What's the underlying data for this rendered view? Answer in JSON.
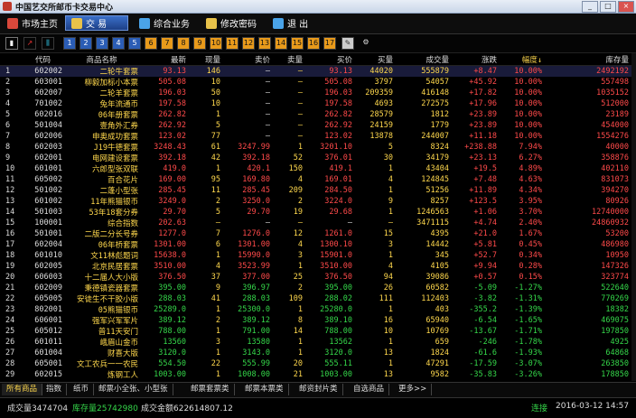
{
  "window": {
    "title": "中国艺交所邮币卡交易中心",
    "min": "_",
    "max": "□",
    "close": "×"
  },
  "menu": [
    {
      "label": "市场主页",
      "icon": "home-icon",
      "color": "#d9483b"
    },
    {
      "label": "交  易",
      "icon": "trade-icon",
      "color": "#e8c24a"
    },
    {
      "label": "综合业务",
      "icon": "business-icon",
      "color": "#4aa3e8"
    },
    {
      "label": "修改密码",
      "icon": "password-icon",
      "color": "#e8c24a"
    },
    {
      "label": "退    出",
      "icon": "exit-icon",
      "color": "#4aa3e8"
    }
  ],
  "toolbar": {
    "buttons": [
      "1",
      "2",
      "3",
      "4",
      "5",
      "6",
      "7",
      "8",
      "9",
      "10",
      "11",
      "12",
      "13",
      "14",
      "15",
      "16",
      "17"
    ]
  },
  "table": {
    "headers": [
      "",
      "代码",
      "商品名称",
      "最新",
      "现量",
      "卖价",
      "卖量",
      "买价",
      "买量",
      "成交量",
      "涨跌",
      "幅度↓",
      "库存量"
    ],
    "rows": [
      [
        "1",
        "602002",
        "二轮牛套票",
        "93.13",
        "146",
        "—",
        "—",
        "93.13",
        "44020",
        "555879",
        "+8.47",
        "10.00%",
        "2492192",
        "up"
      ],
      [
        "2",
        "603001",
        "柳毅加标小本票",
        "505.08",
        "10",
        "—",
        "—",
        "505.08",
        "3797",
        "54057",
        "+45.92",
        "10.00%",
        "557498",
        "up"
      ],
      [
        "3",
        "602007",
        "二轮羊套票",
        "196.03",
        "50",
        "—",
        "—",
        "196.03",
        "209359",
        "416148",
        "+17.82",
        "10.00%",
        "1035152",
        "up"
      ],
      [
        "4",
        "701002",
        "兔年流通币",
        "197.58",
        "10",
        "—",
        "—",
        "197.58",
        "4693",
        "272575",
        "+17.96",
        "10.00%",
        "512000",
        "up"
      ],
      [
        "5",
        "602016",
        "06年册套票",
        "262.82",
        "1",
        "—",
        "—",
        "262.82",
        "28579",
        "1812",
        "+23.89",
        "10.00%",
        "23189",
        "up"
      ],
      [
        "6",
        "501004",
        "壹角外汇券",
        "262.92",
        "5",
        "—",
        "—",
        "262.92",
        "24159",
        "1779",
        "+23.89",
        "10.00%",
        "454000",
        "up"
      ],
      [
        "7",
        "602006",
        "申奥成功套票",
        "123.02",
        "77",
        "—",
        "—",
        "123.02",
        "13878",
        "244007",
        "+11.18",
        "10.00%",
        "1554276",
        "up"
      ],
      [
        "8",
        "602003",
        "J19牛德套票",
        "3248.43",
        "61",
        "3247.99",
        "1",
        "3201.10",
        "5",
        "8324",
        "+238.88",
        "7.94%",
        "40000",
        "up"
      ],
      [
        "9",
        "602001",
        "电网建设套票",
        "392.18",
        "42",
        "392.18",
        "52",
        "376.01",
        "30",
        "34179",
        "+23.13",
        "6.27%",
        "358876",
        "up"
      ],
      [
        "10",
        "601001",
        "六郎型张双联",
        "419.0",
        "1",
        "420.1",
        "150",
        "419.1",
        "1",
        "43404",
        "+19.5",
        "4.89%",
        "402110",
        "up"
      ],
      [
        "11",
        "605002",
        "百合花片",
        "169.00",
        "95",
        "169.80",
        "4",
        "169.01",
        "4",
        "124845",
        "+7.48",
        "4.63%",
        "831073",
        "up"
      ],
      [
        "12",
        "501002",
        "二蓬小型张",
        "285.45",
        "11",
        "285.45",
        "209",
        "284.50",
        "1",
        "51256",
        "+11.89",
        "4.34%",
        "394270",
        "up"
      ],
      [
        "13",
        "601002",
        "11年熊猫银币",
        "3249.0",
        "2",
        "3250.0",
        "2",
        "3224.0",
        "9",
        "8257",
        "+123.5",
        "3.95%",
        "80926",
        "up"
      ],
      [
        "14",
        "501003",
        "53年18套分券",
        "29.70",
        "5",
        "29.70",
        "19",
        "29.68",
        "1",
        "1246563",
        "+1.06",
        "3.70%",
        "12740000",
        "up"
      ],
      [
        "15",
        "100001",
        "综合指数",
        "202.63",
        "—",
        "—",
        "—",
        "—",
        "—",
        "3471115",
        "+4.74",
        "2.40%",
        "24860932",
        "up"
      ],
      [
        "16",
        "501001",
        "二版二分长号券",
        "1277.0",
        "7",
        "1276.0",
        "12",
        "1261.0",
        "15",
        "4395",
        "+21.0",
        "1.67%",
        "53200",
        "up"
      ],
      [
        "17",
        "602004",
        "06年桥套票",
        "1301.00",
        "6",
        "1301.00",
        "4",
        "1300.10",
        "3",
        "14442",
        "+5.81",
        "0.45%",
        "486980",
        "up"
      ],
      [
        "18",
        "601010",
        "文11林彪题词",
        "15638.0",
        "1",
        "15990.0",
        "3",
        "15901.0",
        "1",
        "345",
        "+52.7",
        "0.34%",
        "10950",
        "up"
      ],
      [
        "19",
        "602005",
        "北京民居套票",
        "3510.00",
        "4",
        "3523.99",
        "1",
        "3510.00",
        "4",
        "4105",
        "+9.94",
        "0.28%",
        "147326",
        "up"
      ],
      [
        "20",
        "606003",
        "十二届人大小版",
        "376.50",
        "37",
        "377.00",
        "25",
        "376.50",
        "94",
        "39086",
        "+0.57",
        "0.15%",
        "323774",
        "up"
      ],
      [
        "21",
        "602009",
        "秉德镇瓷器套票",
        "395.00",
        "9",
        "396.97",
        "2",
        "395.00",
        "26",
        "60582",
        "-5.09",
        "-1.27%",
        "522640",
        "dn"
      ],
      [
        "22",
        "605005",
        "安徒生不干胶小版",
        "288.03",
        "41",
        "288.03",
        "109",
        "288.02",
        "111",
        "112403",
        "-3.82",
        "-1.31%",
        "770269",
        "dn"
      ],
      [
        "23",
        "802001",
        "05熊猫银币",
        "25289.0",
        "1",
        "25300.0",
        "1",
        "25280.0",
        "1",
        "403",
        "-355.2",
        "-1.39%",
        "18382",
        "dn"
      ],
      [
        "24",
        "606001",
        "强军兴军军片",
        "389.12",
        "2",
        "389.12",
        "8",
        "389.10",
        "16",
        "65940",
        "-6.54",
        "-1.65%",
        "469075",
        "dn"
      ],
      [
        "25",
        "605012",
        "普11天安门",
        "788.00",
        "1",
        "791.00",
        "14",
        "788.00",
        "10",
        "10769",
        "-13.67",
        "-1.71%",
        "197850",
        "dn"
      ],
      [
        "26",
        "601011",
        "峨眉山金币",
        "13560",
        "3",
        "13580",
        "1",
        "13562",
        "1",
        "659",
        "-246",
        "-1.78%",
        "4925",
        "dn"
      ],
      [
        "27",
        "601004",
        "财喜大版",
        "3120.0",
        "1",
        "3143.0",
        "1",
        "3120.0",
        "13",
        "1824",
        "-61.6",
        "-1.93%",
        "64868",
        "dn"
      ],
      [
        "28",
        "605001",
        "文工农兵一一农民",
        "554.50",
        "22",
        "555.99",
        "20",
        "555.11",
        "1",
        "47291",
        "-17.59",
        "-3.07%",
        "263850",
        "dn"
      ],
      [
        "29",
        "602015",
        "炼钢工人",
        "1003.00",
        "1",
        "1008.00",
        "21",
        "1003.00",
        "13",
        "9582",
        "-35.83",
        "-3.26%",
        "178850",
        "dn"
      ]
    ]
  },
  "tabs": [
    "所有商品",
    "指数",
    "纸币",
    "邮票小全张、小型张",
    "邮票套票类",
    "邮票本票类",
    "邮资封片类",
    "自选商品",
    "更多>>"
  ],
  "status": {
    "volume": "成交量3474704",
    "stock": "库存量25742980",
    "amount": "成交金额622614807.12",
    "conn": "连接",
    "datetime": "2016-03-12  14:57"
  }
}
